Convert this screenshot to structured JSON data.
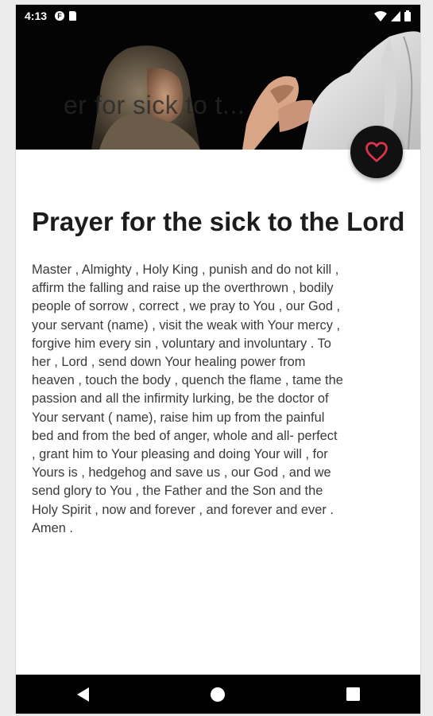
{
  "status_bar": {
    "time": "4:13",
    "left_icons": [
      "notification-f-icon",
      "sd-card-icon"
    ],
    "right_icons": [
      "wifi-icon",
      "signal-icon",
      "battery-icon"
    ]
  },
  "app_bar": {
    "collapsed_title": "er for      sick to t..."
  },
  "fab": {
    "icon": "heart-outline-icon",
    "color": "#d9344a"
  },
  "article": {
    "title": "Prayer for the sick to the Lord",
    "body": "Master , Almighty , Holy King , punish and do not kill ,\naffirm the falling and raise up the overthrown , bodily\npeople of sorrow , correct , we pray to You , our God ,\nyour servant (name) , visit the weak with Your mercy ,\nforgive him every sin , voluntary and involuntary . To\nher , Lord , send down Your healing power from\nheaven , touch the body , quench the flame , tame the\npassion and all the infirmity lurking, be the doctor of\nYour servant ( name), raise him up from the painful\nbed and from the bed of anger, whole and all- perfect\n, grant him to Your pleasing and doing Your will , for\nYours is , hedgehog and save us , our God , and we\nsend glory to You , the Father and the Son and the\nHoly Spirit , now and forever , and forever and ever .\nAmen ."
  },
  "nav_bar": {
    "buttons": [
      "back-icon",
      "home-icon",
      "recents-icon"
    ]
  }
}
